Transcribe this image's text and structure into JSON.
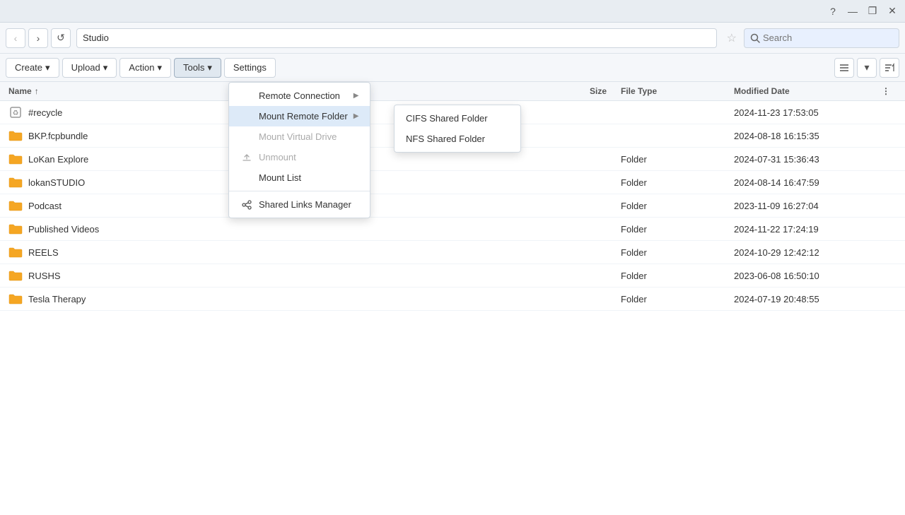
{
  "titlebar": {
    "help_label": "?",
    "minimize_label": "—",
    "restore_label": "❐",
    "close_label": "✕"
  },
  "navbar": {
    "back_label": "‹",
    "forward_label": "›",
    "refresh_label": "↺",
    "address": "Studio",
    "star_label": "☆",
    "search_placeholder": "Search"
  },
  "toolbar": {
    "create_label": "Create",
    "upload_label": "Upload",
    "action_label": "Action",
    "tools_label": "Tools",
    "settings_label": "Settings"
  },
  "filelist": {
    "columns": {
      "name": "Name",
      "size": "Size",
      "type": "File Type",
      "date": "Modified Date"
    },
    "sort_indicator": "↑",
    "rows": [
      {
        "icon": "recycle",
        "name": "#recycle",
        "size": "",
        "type": "",
        "date": "2024-11-23 17:53:05"
      },
      {
        "icon": "folder",
        "name": "BKP.fcpbundle",
        "size": "",
        "type": "",
        "date": "2024-08-18 16:15:35"
      },
      {
        "icon": "folder",
        "name": "LoKan Explore",
        "size": "",
        "type": "Folder",
        "date": "2024-07-31 15:36:43"
      },
      {
        "icon": "folder",
        "name": "lokanSTUDIO",
        "size": "",
        "type": "Folder",
        "date": "2024-08-14 16:47:59"
      },
      {
        "icon": "folder",
        "name": "Podcast",
        "size": "",
        "type": "Folder",
        "date": "2023-11-09 16:27:04"
      },
      {
        "icon": "folder",
        "name": "Published Videos",
        "size": "",
        "type": "Folder",
        "date": "2024-11-22 17:24:19"
      },
      {
        "icon": "folder",
        "name": "REELS",
        "size": "",
        "type": "Folder",
        "date": "2024-10-29 12:42:12"
      },
      {
        "icon": "folder",
        "name": "RUSHS",
        "size": "",
        "type": "Folder",
        "date": "2023-06-08 16:50:10"
      },
      {
        "icon": "folder",
        "name": "Tesla Therapy",
        "size": "",
        "type": "Folder",
        "date": "2024-07-19 20:48:55"
      }
    ]
  },
  "tools_menu": {
    "items": [
      {
        "id": "remote-connection",
        "label": "Remote Connection",
        "has_submenu": true,
        "icon": ""
      },
      {
        "id": "mount-remote-folder",
        "label": "Mount Remote Folder",
        "has_submenu": true,
        "icon": "",
        "highlighted": true
      },
      {
        "id": "mount-virtual-drive",
        "label": "Mount Virtual Drive",
        "has_submenu": false,
        "icon": "",
        "disabled": true
      },
      {
        "id": "unmount",
        "label": "Unmount",
        "has_submenu": false,
        "icon": "eject",
        "disabled": true
      },
      {
        "id": "mount-list",
        "label": "Mount List",
        "has_submenu": false,
        "icon": ""
      },
      {
        "id": "shared-links",
        "label": "Shared Links Manager",
        "has_submenu": false,
        "icon": "share"
      }
    ]
  },
  "mount_remote_submenu": {
    "items": [
      {
        "id": "cifs",
        "label": "CIFS Shared Folder"
      },
      {
        "id": "nfs",
        "label": "NFS Shared Folder"
      }
    ]
  }
}
